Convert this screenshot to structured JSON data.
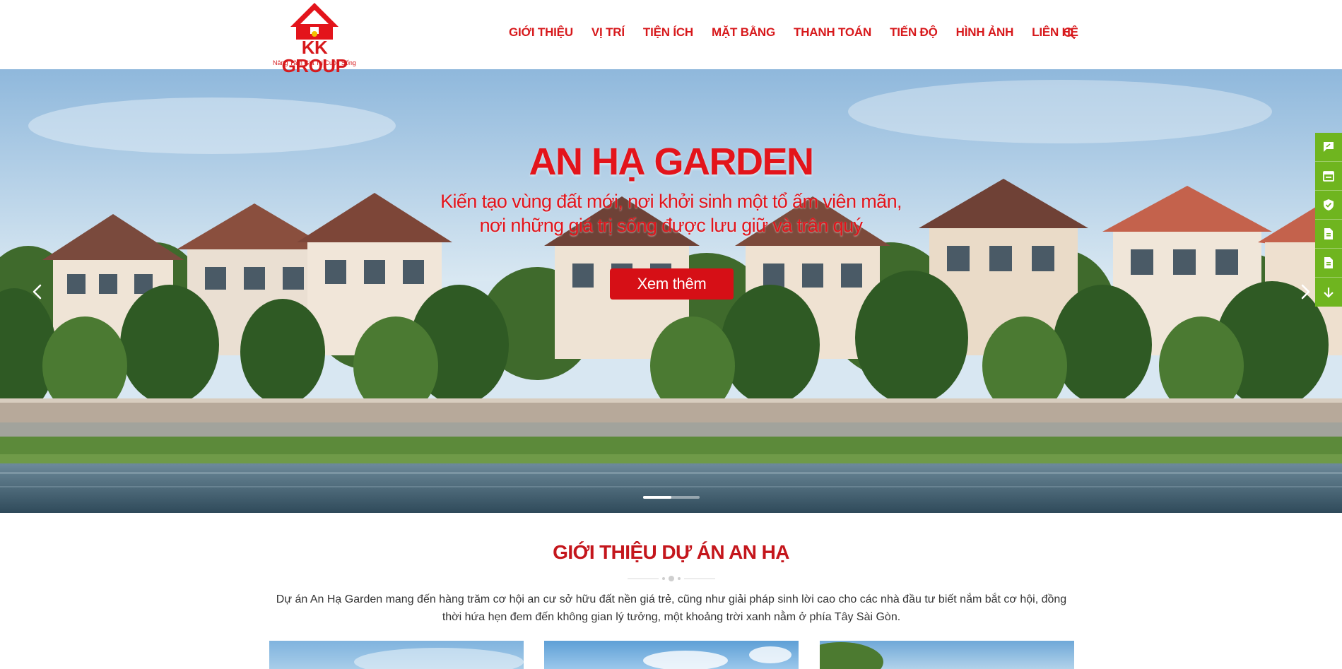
{
  "header": {
    "logo": {
      "name": "KK GROUP",
      "tagline": "Nâng Tầm Giá Trị Cuộc Sống"
    },
    "nav": [
      {
        "label": "GIỚI THIỆU",
        "name": "nav-gioi-thieu"
      },
      {
        "label": "VỊ TRÍ",
        "name": "nav-vi-tri"
      },
      {
        "label": "TIỆN ÍCH",
        "name": "nav-tien-ich"
      },
      {
        "label": "MẶT BẰNG",
        "name": "nav-mat-bang"
      },
      {
        "label": "THANH TOÁN",
        "name": "nav-thanh-toan"
      },
      {
        "label": "TIẾN ĐỘ",
        "name": "nav-tien-do"
      },
      {
        "label": "HÌNH ẢNH",
        "name": "nav-hinh-anh"
      },
      {
        "label": "LIÊN HỆ",
        "name": "nav-lien-he"
      }
    ],
    "search_icon": "search-icon"
  },
  "hero": {
    "title": "AN HẠ GARDEN",
    "subtitle_line1": "Kiến tạo vùng đất mới, nơi khởi sinh một tổ ấm viên mãn,",
    "subtitle_line2": "nơi những giá trị sống được lưu giữ và trân quý",
    "button_label": "Xem thêm",
    "prev_icon": "chevron-left-icon",
    "next_icon": "chevron-right-icon",
    "slide_count": 2,
    "active_slide": 1
  },
  "float_bar": {
    "icons": [
      "feedback-icon",
      "calendar-icon",
      "shield-check-icon",
      "document-icon",
      "document-icon",
      "arrow-down-icon"
    ],
    "color": "#6fb51f"
  },
  "intro": {
    "title": "GIỚI THIỆU DỰ ÁN AN HẠ",
    "text": "Dự án An Hạ Garden mang đến hàng trăm cơ hội an cư sở hữu đất nền giá trẻ, cũng như giải pháp sinh lời cao cho các nhà đầu tư biết nắm bắt cơ hội, đồng thời hứa hẹn đem đến không gian lý tưởng, một khoảng trời xanh nằm ở phía Tây Sài Gòn."
  },
  "colors": {
    "brand_red": "#d7191c",
    "button_red": "#d60f16",
    "accent_green": "#6fb51f"
  }
}
